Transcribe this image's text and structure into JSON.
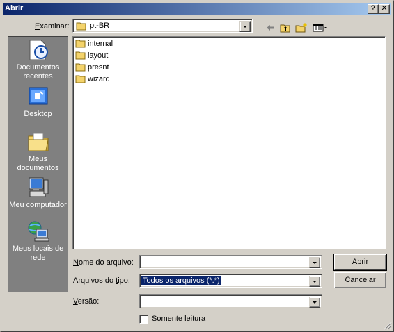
{
  "window": {
    "title": "Abrir",
    "help_label": "?",
    "close_label": "✕"
  },
  "lookin": {
    "label_prefix": "E",
    "label_rest": "xaminar:",
    "value": "pt-BR"
  },
  "places": [
    {
      "label": "Documentos recentes",
      "icon": "recent-documents-icon"
    },
    {
      "label": "Desktop",
      "icon": "desktop-icon"
    },
    {
      "label": "Meus documentos",
      "icon": "my-documents-icon"
    },
    {
      "label": "Meu computador",
      "icon": "my-computer-icon"
    },
    {
      "label": "Meus locais de rede",
      "icon": "network-places-icon"
    }
  ],
  "files": [
    {
      "name": "internal"
    },
    {
      "name": "layout"
    },
    {
      "name": "presnt"
    },
    {
      "name": "wizard"
    }
  ],
  "filename": {
    "label_prefix": "N",
    "label_rest": "ome do arquivo:",
    "value": ""
  },
  "filetype": {
    "label_a": "Arquivos do ",
    "label_u": "t",
    "label_b": "ipo:",
    "value": "Todos os arquivos (*.*)"
  },
  "version": {
    "label_prefix": "V",
    "label_rest": "ersão:",
    "value": ""
  },
  "readonly": {
    "label_a": "Somente ",
    "label_u": "l",
    "label_b": "eitura",
    "checked": false
  },
  "buttons": {
    "open_u": "A",
    "open_rest": "brir",
    "cancel": "Cancelar"
  },
  "colors": {
    "face": "#d4d0c8",
    "title_start": "#0a246a",
    "title_end": "#a6caf0",
    "selection": "#0a246a",
    "places_bg": "#808080",
    "folder": "#f4d36b"
  }
}
